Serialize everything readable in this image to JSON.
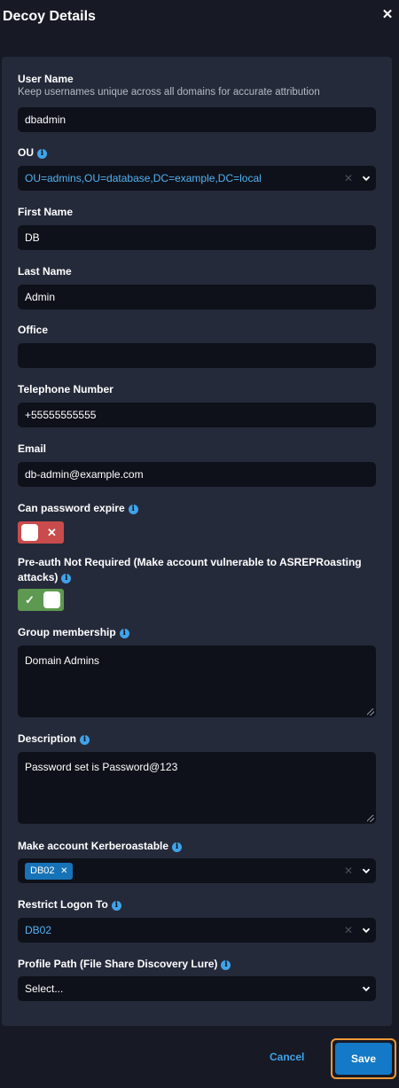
{
  "header": {
    "title": "Decoy Details"
  },
  "form": {
    "username": {
      "label": "User Name",
      "hint": "Keep usernames unique across all domains for accurate attribution",
      "value": "dbadmin"
    },
    "ou": {
      "label": "OU",
      "value": "OU=admins,OU=database,DC=example,DC=local"
    },
    "first_name": {
      "label": "First Name",
      "value": "DB"
    },
    "last_name": {
      "label": "Last Name",
      "value": "Admin"
    },
    "office": {
      "label": "Office",
      "value": ""
    },
    "telephone": {
      "label": "Telephone Number",
      "value": "+55555555555"
    },
    "email": {
      "label": "Email",
      "value": "db-admin@example.com"
    },
    "can_password_expire": {
      "label": "Can password expire",
      "enabled": false
    },
    "preauth_not_required": {
      "label": "Pre-auth Not Required (Make account vulnerable to ASREPRoasting attacks)",
      "enabled": true
    },
    "group_membership": {
      "label": "Group membership",
      "value": "Domain Admins"
    },
    "description": {
      "label": "Description",
      "value": "Password set is Password@123"
    },
    "kerberoastable": {
      "label": "Make account Kerberoastable",
      "chips": [
        "DB02"
      ]
    },
    "restrict_logon": {
      "label": "Restrict Logon To",
      "value": "DB02"
    },
    "profile_path": {
      "label": "Profile Path (File Share Discovery Lure)",
      "placeholder": "Select..."
    }
  },
  "footer": {
    "cancel_label": "Cancel",
    "save_label": "Save"
  },
  "colors": {
    "background": "#171a25",
    "panel": "#252a3a",
    "input": "#0e111a",
    "accent": "#3fa3ea",
    "toggle_off": "#c94b4b",
    "toggle_on": "#5d9950",
    "save_button": "#1479c6",
    "focus_outline": "#f19a39"
  },
  "icons": {
    "close": "close-icon",
    "info": "info-icon",
    "chevron": "chevron-down-icon",
    "clear": "clear-icon"
  }
}
